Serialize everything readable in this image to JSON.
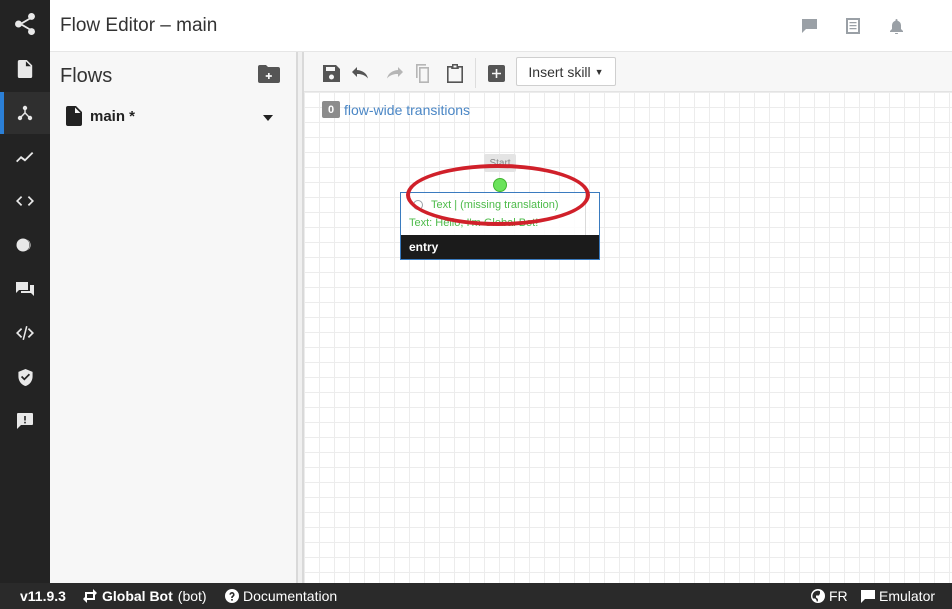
{
  "header": {
    "title": "Flow Editor – main",
    "icons": [
      "chat-icon",
      "document-icon",
      "bell-icon"
    ]
  },
  "rail": {
    "items": [
      "logo-icon",
      "content-icon",
      "flows-icon",
      "analytics-icon",
      "code-icon",
      "toggle-icon",
      "qna-icon",
      "nlu-icon",
      "shield-icon",
      "feedback-icon"
    ],
    "active": "flows-icon",
    "accent": "#2b7fd6"
  },
  "flows_panel": {
    "heading": "Flows",
    "items": [
      {
        "name": "main *"
      }
    ]
  },
  "toolbar": {
    "insert_skill": "Insert skill"
  },
  "canvas": {
    "flow_wide": {
      "count": "0",
      "label": "flow-wide transitions"
    },
    "start_label": "Start",
    "node": {
      "row1": "Text | (missing translation)",
      "row2": "Text: Hello, I'm Global Bot!",
      "footer": "entry"
    }
  },
  "status": {
    "version": "v11.9.3",
    "bot": "Global Bot",
    "bot_suffix": "(bot)",
    "documentation": "Documentation",
    "language": "FR",
    "emulator": "Emulator"
  }
}
